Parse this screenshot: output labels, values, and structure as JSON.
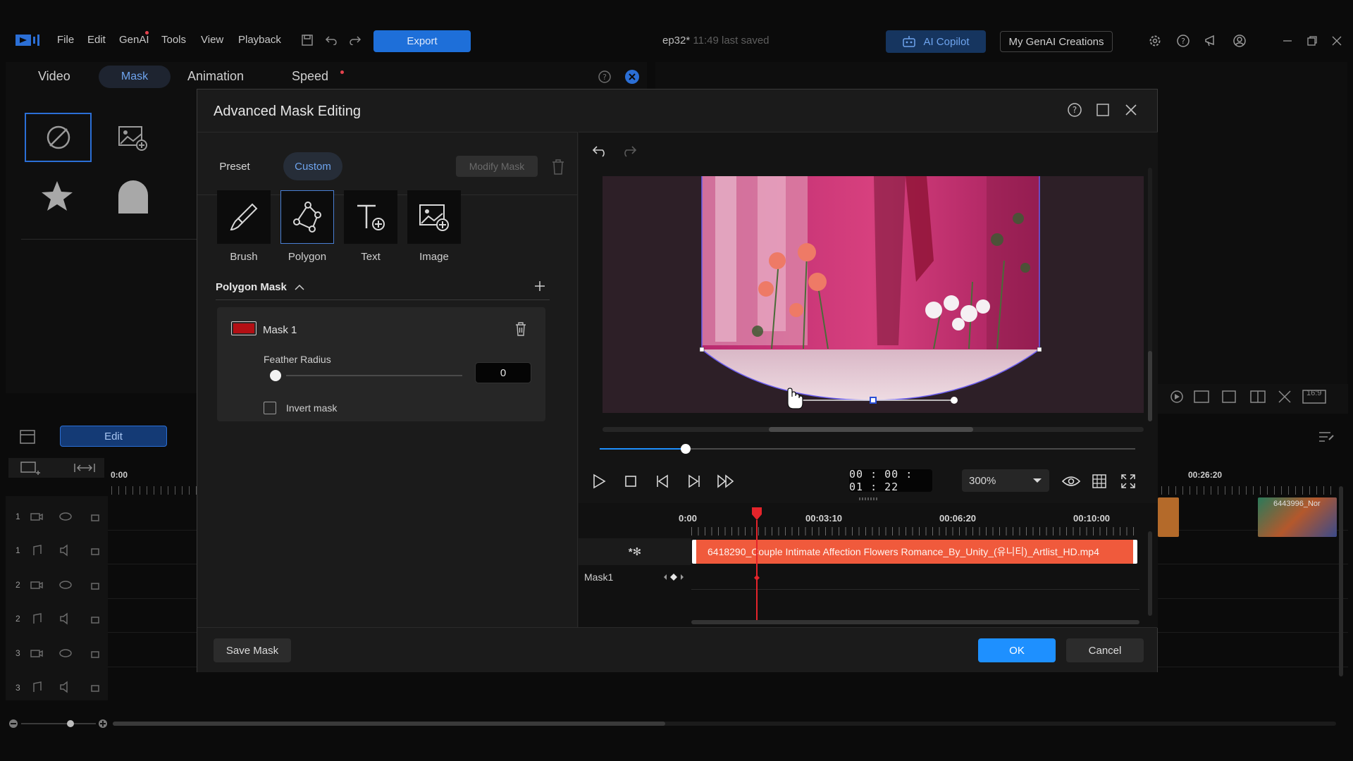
{
  "app": {
    "menu": [
      "File",
      "Edit",
      "GenAI",
      "Tools",
      "View",
      "Playback"
    ],
    "export_label": "Export",
    "project_name": "ep32*",
    "last_saved": "11:49 last saved",
    "copilot_label": "AI Copilot",
    "creations_label": "My GenAI Creations"
  },
  "property_tabs": [
    "Video",
    "Mask",
    "Animation",
    "Speed"
  ],
  "background": {
    "edit_label": "Edit",
    "timeline_start": "0:00",
    "timeline_mark": "00:26:20",
    "right_clip_name": "6443996_Nor",
    "track_numbers": [
      "1",
      "1",
      "2",
      "2",
      "3",
      "3"
    ],
    "aspect_label": "16:9"
  },
  "dialog": {
    "title": "Advanced Mask Editing",
    "tabs": {
      "preset": "Preset",
      "custom": "Custom"
    },
    "modify_mask_label": "Modify Mask",
    "tools": [
      {
        "label": "Brush",
        "icon": "brush-icon"
      },
      {
        "label": "Polygon",
        "icon": "polygon-icon"
      },
      {
        "label": "Text",
        "icon": "text-icon"
      },
      {
        "label": "Image",
        "icon": "image-icon"
      }
    ],
    "section_title": "Polygon Mask",
    "mask": {
      "name": "Mask 1",
      "color": "#b30f14",
      "feather_label": "Feather Radius",
      "feather_value": "0",
      "feather_fraction": 0,
      "invert_label": "Invert mask",
      "invert_checked": false
    },
    "save_mask_label": "Save Mask",
    "ok_label": "OK",
    "cancel_label": "Cancel",
    "player": {
      "timecode": "00 : 00 : 01 : 22",
      "zoom": "300%",
      "playhead_fraction": 0.16
    },
    "timeline": {
      "ruler": [
        "0:00",
        "00:03:10",
        "00:06:20",
        "00:10:00"
      ],
      "clip_name": "6418290_Couple Intimate Affection Flowers Romance_By_Unity_(유니티)_Artlist_HD.mp4",
      "mask_track_label": "Mask1"
    },
    "accent": "#1e90ff"
  }
}
